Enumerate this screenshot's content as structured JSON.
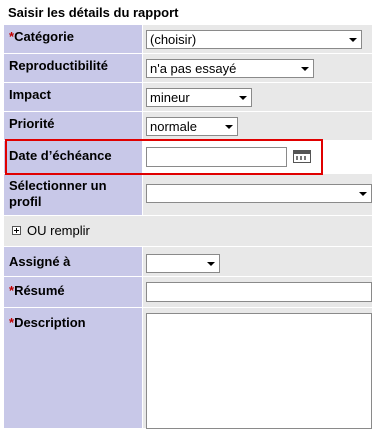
{
  "form": {
    "title": "Saisir les détails du rapport",
    "required_marker": "*",
    "fields": {
      "categorie": {
        "label": "Catégorie",
        "required": true,
        "value": "(choisir)"
      },
      "reproductibilite": {
        "label": "Reproductibilité",
        "value": "n'a pas essayé"
      },
      "impact": {
        "label": "Impact",
        "value": "mineur"
      },
      "priorite": {
        "label": "Priorité",
        "value": "normale"
      },
      "date_echeance": {
        "label": "Date d’échéance",
        "value": ""
      },
      "profil": {
        "label": "Sélectionner un profil",
        "value": ""
      },
      "or_fill": {
        "label": "OU remplir"
      },
      "assigne": {
        "label": "Assigné à",
        "value": ""
      },
      "resume": {
        "label": "Résumé",
        "required": true,
        "value": ""
      },
      "description": {
        "label": "Description",
        "required": true,
        "value": ""
      }
    }
  },
  "colors": {
    "label_bg": "#c8c8e8",
    "value_bg": "#e8e8e8",
    "required": "#c00000",
    "highlight": "#e00000"
  }
}
